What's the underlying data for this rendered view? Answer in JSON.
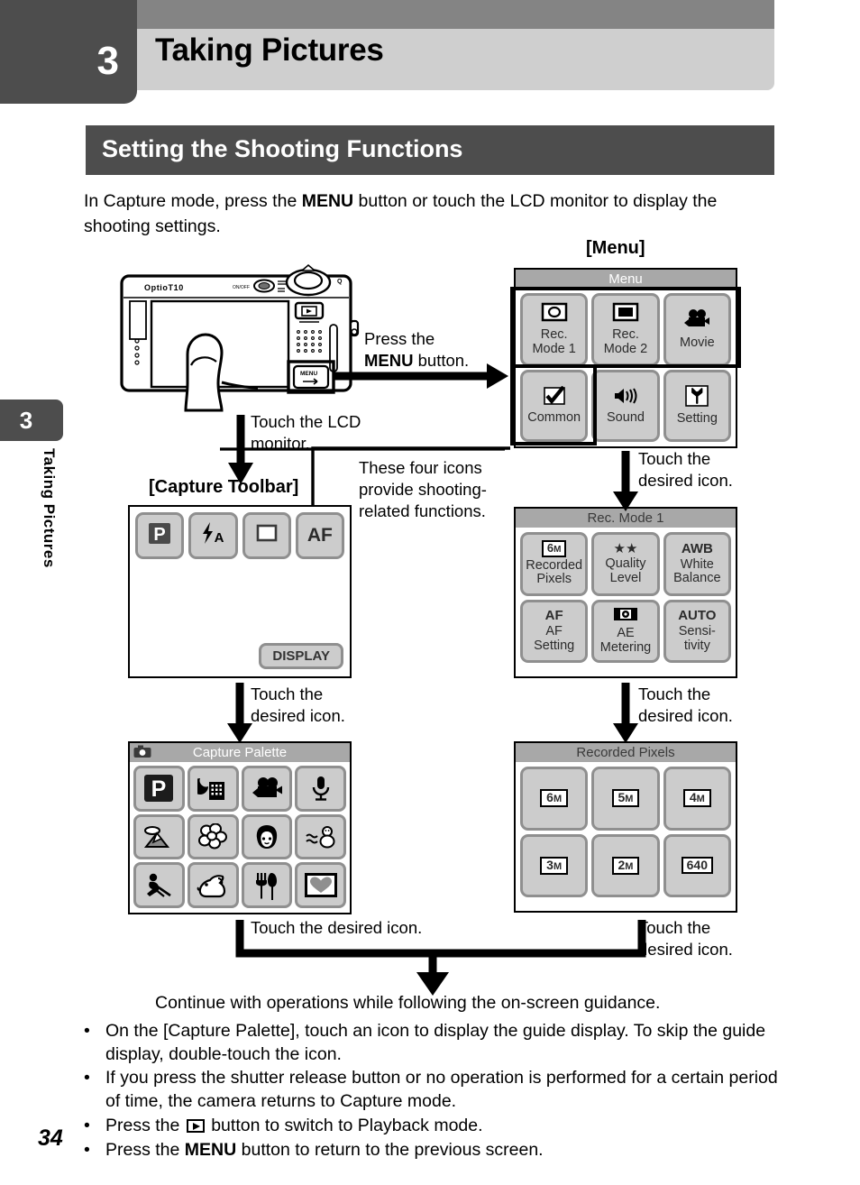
{
  "header": {
    "chapter_number": "3",
    "chapter_title": "Taking Pictures",
    "section_title": "Setting the Shooting Functions"
  },
  "side_tab": {
    "number": "3",
    "vertical_label": "Taking Pictures"
  },
  "intro": {
    "part1": "In Capture mode, press the ",
    "menu_bold": "MENU",
    "part2": " button or touch the LCD monitor to display the shooting settings."
  },
  "camera": {
    "model_label": "OptioT10",
    "onoff_label": "ON/OFF",
    "menu_button_label": "MENU",
    "playback_icon": "playback-icon"
  },
  "annotations": {
    "press_menu_1": "Press the",
    "press_menu_2": "MENU",
    "press_menu_3": " button.",
    "touch_lcd": "Touch the LCD monitor.",
    "four_icons": "These four icons provide shooting-related functions.",
    "touch_desired_1": "Touch the desired icon.",
    "touch_desired_2": "Touch the desired icon.",
    "touch_desired_3": "Touch the desired icon.",
    "touch_desired_4": "Touch the desired icon.",
    "touch_desired_5": "Touch the desired icon.",
    "continue": "Continue with operations while following the on-screen guidance."
  },
  "menu_screen": {
    "bracket_label": "[Menu]",
    "title": "Menu",
    "tiles": [
      {
        "icon": "rec-mode-1-icon",
        "label": "Rec.\nMode 1"
      },
      {
        "icon": "rec-mode-2-icon",
        "label": "Rec.\nMode 2"
      },
      {
        "icon": "movie-icon",
        "label": "Movie"
      },
      {
        "icon": "common-check-icon",
        "label": "Common"
      },
      {
        "icon": "sound-speaker-icon",
        "label": "Sound"
      },
      {
        "icon": "setting-wrench-icon",
        "label": "Setting"
      }
    ]
  },
  "toolbar_screen": {
    "bracket_label": "[Capture Toolbar]",
    "buttons": [
      {
        "icon": "program-mode-icon",
        "label": "P"
      },
      {
        "icon": "flash-auto-icon",
        "label": "⚡A"
      },
      {
        "icon": "drive-mode-icon",
        "label": "□"
      },
      {
        "icon": "focus-mode-icon",
        "label": "AF"
      }
    ],
    "display_button": "DISPLAY"
  },
  "recmode_screen": {
    "title": "Rec. Mode 1",
    "tiles": [
      {
        "badge": "6M",
        "badge_style": "boxed",
        "label": "Recorded\nPixels"
      },
      {
        "badge": "★★",
        "badge_style": "plain",
        "label": "Quality\nLevel"
      },
      {
        "badge": "AWB",
        "badge_style": "plain-bold",
        "label": "White\nBalance"
      },
      {
        "badge": "AF",
        "badge_style": "plain-bold",
        "label": "AF\nSetting"
      },
      {
        "badge": "ae-metering-icon",
        "badge_style": "icon",
        "label": "AE\nMetering"
      },
      {
        "badge": "AUTO",
        "badge_style": "plain-bold",
        "label": "Sensi-\ntivity"
      }
    ]
  },
  "recpix_screen": {
    "title": "Recorded Pixels",
    "tiles": [
      "6M",
      "5M",
      "4M",
      "3M",
      "2M",
      "640"
    ]
  },
  "palette_screen": {
    "title": "Capture Palette",
    "header_icon": "camera-icon",
    "tiles": [
      {
        "icon": "program-mode-icon",
        "name": "Program",
        "selected": true
      },
      {
        "icon": "night-scene-icon",
        "name": "Night Scene"
      },
      {
        "icon": "movie-icon",
        "name": "Movie"
      },
      {
        "icon": "voice-recording-icon",
        "name": "Voice Recording"
      },
      {
        "icon": "landscape-icon",
        "name": "Landscape"
      },
      {
        "icon": "flower-icon",
        "name": "Flower"
      },
      {
        "icon": "portrait-icon",
        "name": "Portrait"
      },
      {
        "icon": "surf-snow-icon",
        "name": "Surf & Snow"
      },
      {
        "icon": "sport-icon",
        "name": "Sport"
      },
      {
        "icon": "pet-icon",
        "name": "Pet"
      },
      {
        "icon": "food-icon",
        "name": "Food"
      },
      {
        "icon": "frame-composite-icon",
        "name": "Frame Composite"
      }
    ]
  },
  "bullets": [
    {
      "bullet": "•",
      "pre": "On the [Capture Palette], touch an icon to display the guide display. To skip the guide display, double-touch the icon.",
      "icon": "",
      "post": ""
    },
    {
      "bullet": "•",
      "pre": "If you press the shutter release button or no operation is performed for a certain period of time, the camera returns to Capture mode.",
      "icon": "",
      "post": ""
    },
    {
      "bullet": "•",
      "pre": "Press the ",
      "icon": "playback-icon",
      "post": " button to switch to Playback mode."
    },
    {
      "bullet": "•",
      "pre": "Press the ",
      "icon": "menu-bold",
      "post": " button to return to the previous screen."
    }
  ],
  "page_number": "34",
  "colors": {
    "chapter_tab": "#4d4d4d",
    "header_top": "#848484",
    "header_main": "#cfcfcf",
    "section_bar": "#4d4d4d",
    "screen_title": "#a8a8a8",
    "tile_face": "#cccccc",
    "tile_border": "#8f8f8f"
  }
}
